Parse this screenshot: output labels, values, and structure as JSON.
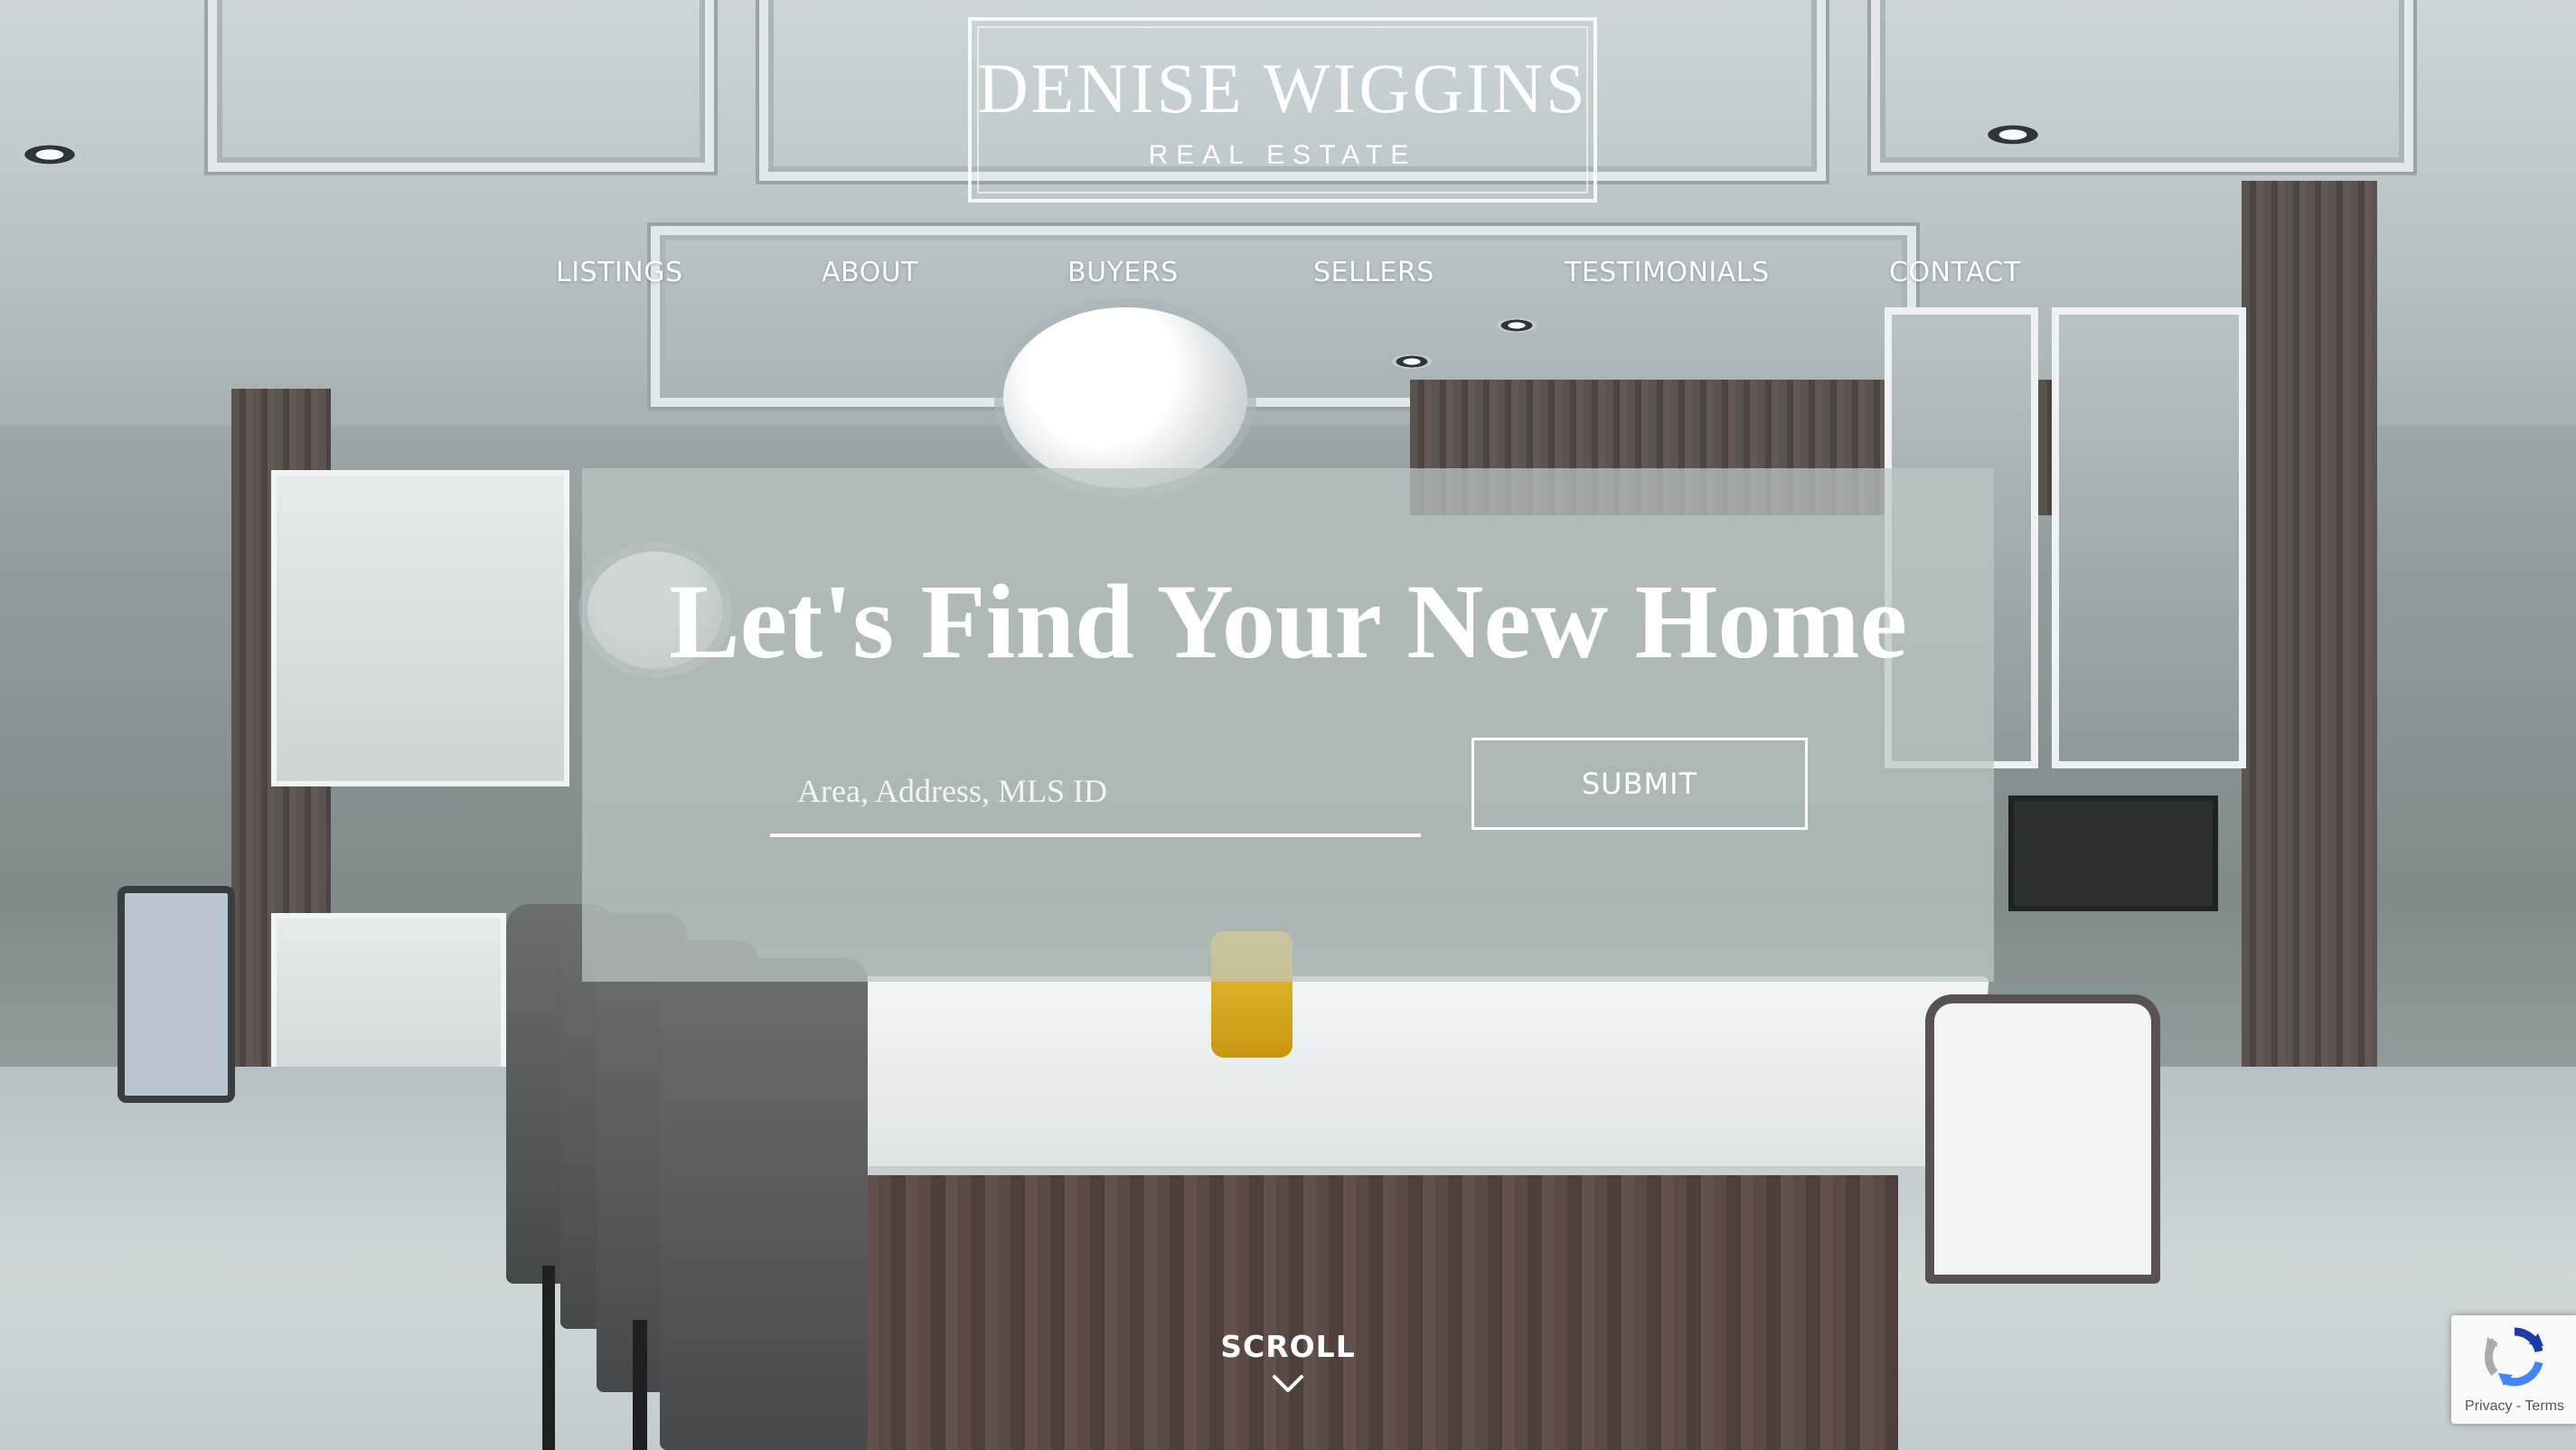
{
  "brand": {
    "name": "DENISE WIGGINS",
    "tagline": "REAL ESTATE"
  },
  "nav": {
    "items": [
      {
        "label": "LISTINGS"
      },
      {
        "label": "ABOUT"
      },
      {
        "label": "BUYERS"
      },
      {
        "label": "SELLERS"
      },
      {
        "label": "TESTIMONIALS"
      },
      {
        "label": "CONTACT"
      }
    ]
  },
  "hero": {
    "title": "Let's Find Your New Home",
    "search": {
      "value": "",
      "placeholder": "Area, Address, MLS ID"
    },
    "submit_label": "SUBMIT"
  },
  "scroll": {
    "label": "SCROLL",
    "icon": "chevron-down-icon"
  },
  "recaptcha": {
    "icon": "recaptcha-icon",
    "links": "Privacy - Terms"
  },
  "colors": {
    "text": "#ffffff",
    "panel": "#bcc6c4",
    "recaptcha_blue": "#1c3aa9"
  }
}
